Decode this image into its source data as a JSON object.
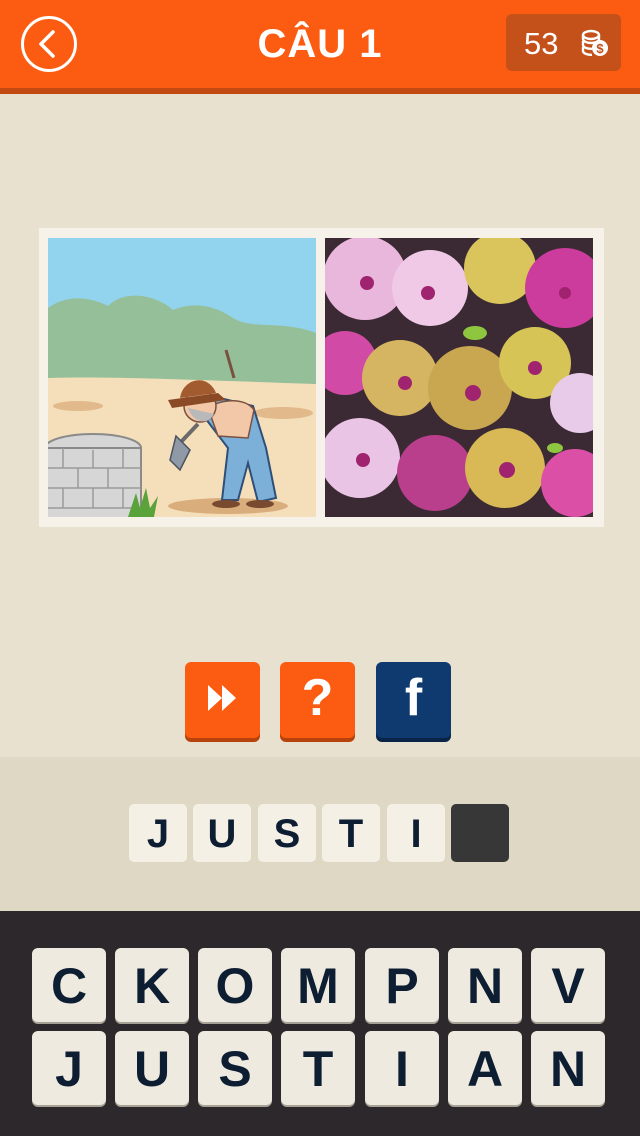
{
  "header": {
    "title": "CÂU 1",
    "coins": "53",
    "back_icon": "chevron-left-icon",
    "coin_icon": "coin-stack-icon",
    "colors": {
      "bar": "#fb5c12",
      "coin_box": "#c4501a"
    }
  },
  "puzzle": {
    "images": [
      {
        "subject": "cartoon farmer digging with shovel near well"
      },
      {
        "subject": "orchid flowers"
      }
    ]
  },
  "actions": {
    "skip_icon": "fast-forward-icon",
    "hint_label": "?",
    "facebook_label": "f",
    "colors": {
      "orange": "#fb5c12",
      "facebook": "#0e3a70"
    }
  },
  "answer": {
    "slots": [
      "J",
      "U",
      "S",
      "T",
      "I",
      ""
    ]
  },
  "keyboard": {
    "rows": [
      [
        "C",
        "K",
        "O",
        "M",
        "P",
        "N",
        "V"
      ],
      [
        "J",
        "U",
        "S",
        "T",
        "I",
        "A",
        "N"
      ]
    ]
  }
}
